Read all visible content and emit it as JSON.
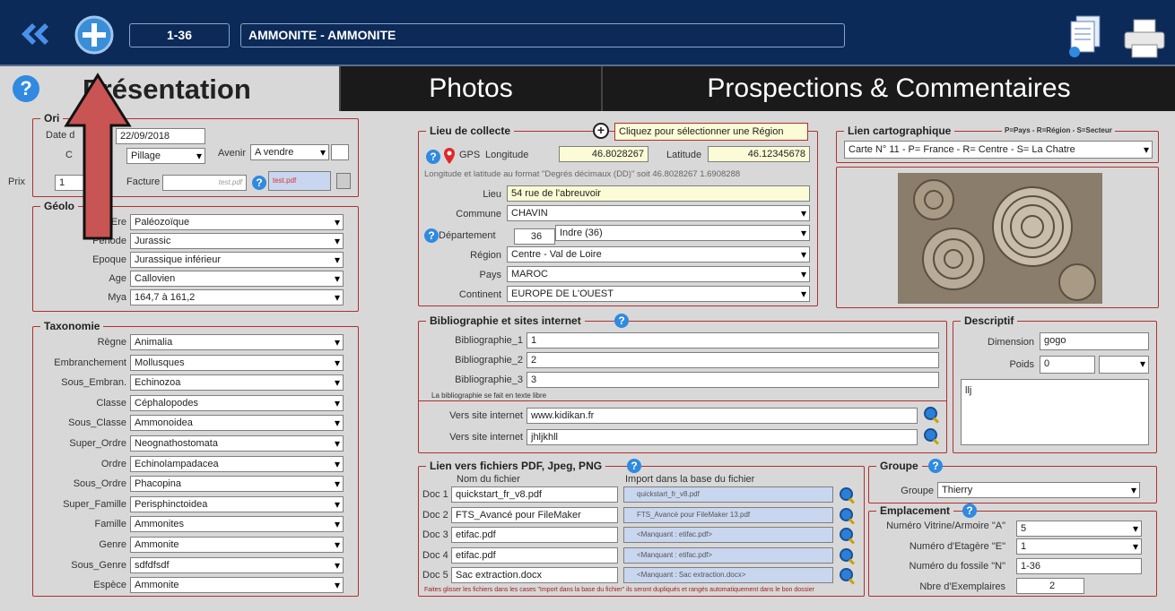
{
  "header": {
    "record": "1-36",
    "title": "AMMONITE - AMMONITE"
  },
  "tabs": [
    "Présentation",
    "Photos",
    "Prospections & Commentaires"
  ],
  "origine": {
    "title": "Ori",
    "date_label": "Date d",
    "date": "22/09/2018",
    "mode_label": "C",
    "mode": "Pillage",
    "avenir_label": "Avenir",
    "avenir": "A vendre",
    "prix_label": "Prix",
    "prix": "1",
    "facture_label": "Facture",
    "facture_placeholder": "test.pdf",
    "facture_file": "test.pdf"
  },
  "geologie": {
    "title": "Géolo",
    "rows": [
      {
        "label": "Ere",
        "value": "Paléozoïque"
      },
      {
        "label": "Période",
        "value": "Jurassic"
      },
      {
        "label": "Epoque",
        "value": "Jurassique inférieur"
      },
      {
        "label": "Age",
        "value": "Callovien"
      },
      {
        "label": "Mya",
        "value": "164,7 à 161,2"
      }
    ]
  },
  "taxonomie": {
    "title": "Taxonomie",
    "rows": [
      {
        "label": "Règne",
        "value": "Animalia"
      },
      {
        "label": "Embranchement",
        "value": "Mollusques"
      },
      {
        "label": "Sous_Embran.",
        "value": "Echinozoa"
      },
      {
        "label": "Classe",
        "value": "Céphalopodes"
      },
      {
        "label": "Sous_Classe",
        "value": "Ammonoidea"
      },
      {
        "label": "Super_Ordre",
        "value": "Neognathostomata"
      },
      {
        "label": "Ordre",
        "value": "Echinolampadacea"
      },
      {
        "label": "Sous_Ordre",
        "value": "Phacopina"
      },
      {
        "label": "Super_Famille",
        "value": "Perisphinctoidea"
      },
      {
        "label": "Famille",
        "value": "Ammonites"
      },
      {
        "label": "Genre",
        "value": "Ammonite"
      },
      {
        "label": "Sous_Genre",
        "value": "sdfdfsdf"
      },
      {
        "label": "Espèce",
        "value": "Ammonite"
      }
    ]
  },
  "lieu": {
    "title": "Lieu de collecte",
    "region_button": "Cliquez pour sélectionner une Région",
    "gps": "GPS",
    "longitude_label": "Longitude",
    "longitude": "46.8028267",
    "latitude_label": "Latitude",
    "latitude": "46.12345678",
    "note": "Longitude et latitude au format \"Degrés décimaux (DD)\" soit 46.8028267  1.6908288",
    "lieu_label": "Lieu",
    "lieu": "54 rue de l'abreuvoir",
    "commune_label": "Commune",
    "commune": "CHAVIN",
    "departement_label": "Département",
    "dep_num": "36",
    "departement": "Indre (36)",
    "region_label": "Région",
    "region": "Centre - Val de Loire",
    "pays_label": "Pays",
    "pays": "MAROC",
    "continent_label": "Continent",
    "continent": "EUROPE DE L'OUEST"
  },
  "carto": {
    "title": "Lien cartographique",
    "legend": "P=Pays - R=Région - S=Secteur",
    "value": "Carte N° 11  -  P= France  -  R= Centre  -  S= La Chatre"
  },
  "biblio": {
    "title": "Bibliographie et sites internet",
    "items": [
      {
        "label": "Bibliographie_1",
        "value": "1"
      },
      {
        "label": "Bibliographie_2",
        "value": "2"
      },
      {
        "label": "Bibliographie_3",
        "value": "3"
      }
    ],
    "note": "La bibliographie se fait en texte libre",
    "sites": [
      {
        "label": "Vers site internet",
        "value": "www.kidikan.fr"
      },
      {
        "label": "Vers site internet",
        "value": "jhljkhll"
      }
    ]
  },
  "descriptif": {
    "title": "Descriptif",
    "dimension_label": "Dimension",
    "dimension": "gogo",
    "poids_label": "Poids",
    "poids": "0",
    "text": "llj"
  },
  "fichiers": {
    "title": "Lien vers fichiers PDF, Jpeg, PNG",
    "col1": "Nom du fichier",
    "col2": "Import dans la base du fichier",
    "docs": [
      {
        "label": "Doc 1",
        "name": "quickstart_fr_v8.pdf",
        "import": "quickstart_fr_v8.pdf"
      },
      {
        "label": "Doc 2",
        "name": "FTS_Avancé pour FileMaker",
        "import": "FTS_Avancé pour FileMaker 13.pdf"
      },
      {
        "label": "Doc 3",
        "name": "etifac.pdf",
        "import": "<Manquant : etifac.pdf>"
      },
      {
        "label": "Doc 4",
        "name": "etifac.pdf",
        "import": "<Manquant : etifac.pdf>"
      },
      {
        "label": "Doc 5",
        "name": "Sac extraction.docx",
        "import": "<Manquant : Sac extraction.docx>"
      }
    ],
    "note": "Faites glisser les fichiers dans les cases \"Import dans la base du fichier\" ils seront dupliqués et rangés automatiquement dans le bon dossier"
  },
  "groupe": {
    "title": "Groupe",
    "label": "Groupe",
    "value": "Thierry"
  },
  "emplacement": {
    "title": "Emplacement",
    "vitrine_label": "Numéro Vitrine/Armoire  \"A\"",
    "vitrine": "5",
    "etagere_label": "Numéro d'Etagère  \"E\"",
    "etagere": "1",
    "fossile_label": "Numéro du fossile  \"N\"",
    "fossile": "1-36",
    "exemplaires_label": "Nbre d'Exemplaires",
    "exemplaires": "2"
  }
}
